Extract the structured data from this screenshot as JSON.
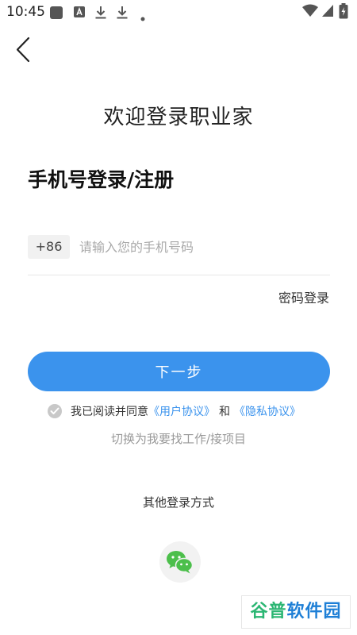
{
  "status_bar": {
    "time": "10:45",
    "notification_icons": [
      "app-icon",
      "a-icon",
      "download-icon",
      "download-icon",
      "dot-icon"
    ],
    "system_icons": [
      "wifi-icon",
      "signal-icon",
      "battery-charging-icon"
    ]
  },
  "header": {
    "back_icon": "chevron-left-icon"
  },
  "welcome_title": "欢迎登录职业家",
  "login_heading": "手机号登录/注册",
  "phone": {
    "country_code": "+86",
    "placeholder": "请输入您的手机号码",
    "value": ""
  },
  "password_login_label": "密码登录",
  "next_button_label": "下一步",
  "agreement": {
    "prefix": "我已阅读并同意",
    "user_agreement": "《用户协议》",
    "and": "和",
    "privacy_agreement": "《隐私协议》"
  },
  "switch_role_label": "切换为我要找工作/接项目",
  "other_login_label": "其他登录方式",
  "wechat_icon": "wechat-icon",
  "watermark": {
    "part1": "谷普",
    "part2": "软件园"
  },
  "colors": {
    "accent": "#3b93ed",
    "wechat_green": "#4cbf4b",
    "background": "#ffffff"
  }
}
